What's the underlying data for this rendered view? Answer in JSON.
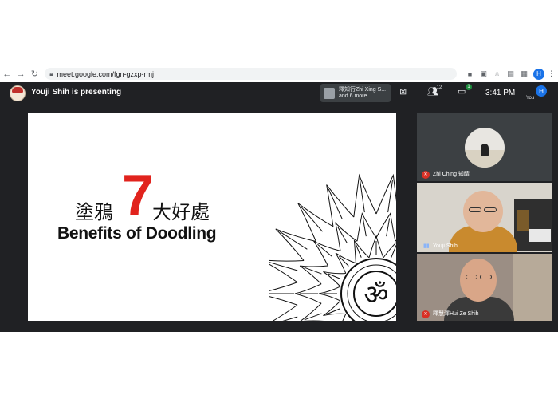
{
  "browser": {
    "url": "meet.google.com/fgn-gzxp-rmj",
    "nav": {
      "back": "←",
      "forward": "→",
      "reload": "↻"
    }
  },
  "meet": {
    "presenter_text": "Youji Shih is presenting",
    "participants_chip": {
      "line1": "釋知行Zhi Xing S...",
      "line2": "and 6 more"
    },
    "people_count": "12",
    "chat_count": "1",
    "time": "3:41 PM",
    "self_initial": "H",
    "self_label": "You"
  },
  "slide": {
    "cn_left": "塗鴉",
    "number": "7",
    "cn_right": "大好處",
    "english": "Benefits of Doodling",
    "om": "ॐ"
  },
  "tiles": [
    {
      "name": "Zhi Ching 知晴",
      "mic": "muted"
    },
    {
      "name": "Youji Shih",
      "mic": "speaking"
    },
    {
      "name": "釋慧澤Hui Ze Shih",
      "mic": "muted"
    }
  ],
  "colors": {
    "accent_red": "#e1231d",
    "meet_bg": "#202124",
    "profile_blue": "#1a73e8"
  }
}
